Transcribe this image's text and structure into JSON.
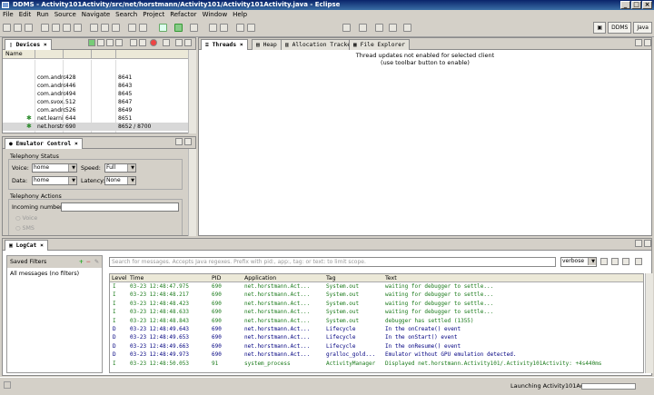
{
  "window": {
    "title": "DDMS - Activity101Activity/src/net/horstmann/Activity101/Activity101Activity.java - Eclipse",
    "buttons": [
      "_",
      "□",
      "×"
    ]
  },
  "menu": [
    "File",
    "Edit",
    "Run",
    "Source",
    "Navigate",
    "Search",
    "Project",
    "Refactor",
    "Window",
    "Help"
  ],
  "perspectives": [
    "DDMS",
    "Java"
  ],
  "devices": {
    "tab_label": "Devices",
    "column_name": "Name",
    "rows": [
      {
        "name": "com.andrc",
        "pid": "428",
        "port": "8641"
      },
      {
        "name": "com.andrc",
        "pid": "446",
        "port": "8643"
      },
      {
        "name": "com.andrc",
        "pid": "494",
        "port": "8645"
      },
      {
        "name": "com.svox.",
        "pid": "512",
        "port": "8647"
      },
      {
        "name": "com.andrc",
        "pid": "526",
        "port": "8649"
      },
      {
        "name": "net.learni",
        "pid": "644",
        "port": "8651"
      },
      {
        "name": "net.horstr",
        "pid": "690",
        "port": "8652 / 8700"
      }
    ]
  },
  "emulator": {
    "tab_label": "Emulator Control",
    "telephony_status": "Telephony Status",
    "voice_label": "Voice:",
    "voice_value": "home",
    "speed_label": "Speed:",
    "speed_value": "Full",
    "data_label": "Data:",
    "data_value": "home",
    "latency_label": "Latency:",
    "latency_value": "None",
    "telephony_actions": "Telephony Actions",
    "incoming_label": "Incoming number:",
    "incoming_value": "",
    "radio_voice": "Voice",
    "radio_sms": "SMS"
  },
  "right_tabs": [
    "Threads",
    "Heap",
    "Allocation Tracker",
    "File Explorer"
  ],
  "threads_message_1": "Thread updates not enabled for selected client",
  "threads_message_2": "(use toolbar button to enable)",
  "logcat": {
    "tab_label": "LogCat",
    "saved_filters": "Saved Filters",
    "filter_item": "All messages (no filters)",
    "search_placeholder": "Search for messages. Accepts Java regexes. Prefix with pid:, app:, tag: or text: to limit scope.",
    "level_select": "verbose",
    "columns": [
      "Level",
      "Time",
      "PID",
      "Application",
      "Tag",
      "Text"
    ],
    "rows": [
      {
        "level": "I",
        "time": "03-23 12:48:47.975",
        "pid": "690",
        "app": "net.horstmann.Act...",
        "tag": "System.out",
        "text": "waiting for debugger to settle..."
      },
      {
        "level": "I",
        "time": "03-23 12:48:48.217",
        "pid": "690",
        "app": "net.horstmann.Act...",
        "tag": "System.out",
        "text": "waiting for debugger to settle..."
      },
      {
        "level": "I",
        "time": "03-23 12:48:48.423",
        "pid": "690",
        "app": "net.horstmann.Act...",
        "tag": "System.out",
        "text": "waiting for debugger to settle..."
      },
      {
        "level": "I",
        "time": "03-23 12:48:48.633",
        "pid": "690",
        "app": "net.horstmann.Act...",
        "tag": "System.out",
        "text": "waiting for debugger to settle..."
      },
      {
        "level": "I",
        "time": "03-23 12:48:48.843",
        "pid": "690",
        "app": "net.horstmann.Act...",
        "tag": "System.out",
        "text": "debugger has settled (1355)"
      },
      {
        "level": "D",
        "time": "03-23 12:48:49.643",
        "pid": "690",
        "app": "net.horstmann.Act...",
        "tag": "Lifecycle",
        "text": "In the onCreate() event"
      },
      {
        "level": "D",
        "time": "03-23 12:48:49.653",
        "pid": "690",
        "app": "net.horstmann.Act...",
        "tag": "Lifecycle",
        "text": "In the onStart() event"
      },
      {
        "level": "D",
        "time": "03-23 12:48:49.663",
        "pid": "690",
        "app": "net.horstmann.Act...",
        "tag": "Lifecycle",
        "text": "In the onResume() event"
      },
      {
        "level": "D",
        "time": "03-23 12:48:49.973",
        "pid": "690",
        "app": "net.horstmann.Act...",
        "tag": "gralloc_gold...",
        "text": "Emulator without GPU emulation detected."
      },
      {
        "level": "I",
        "time": "03-23 12:48:50.053",
        "pid": "91",
        "app": "system_process",
        "tag": "ActivityManager",
        "text": "Displayed net.horstmann.Activity101/.Activity101Activity: +4s440ms"
      }
    ]
  },
  "status_text": "Launching Activity101Activity",
  "colors": {
    "info": "#1a7a1a",
    "debug": "#000080",
    "title_bar": "#0a246a"
  }
}
